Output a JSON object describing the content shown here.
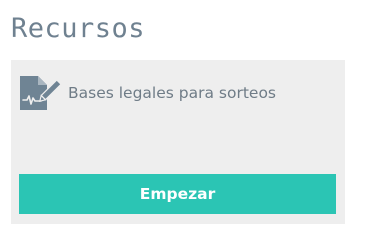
{
  "section": {
    "title": "Recursos"
  },
  "resources": [
    {
      "label": "Bases legales para sorteos",
      "icon": "document-signature-icon"
    }
  ],
  "action": {
    "button_label": "Empezar"
  },
  "colors": {
    "title": "#6f8190",
    "card_background": "#eeeeee",
    "icon": "#6f8494",
    "label": "#6f7c87",
    "button_background": "#2bc5b4",
    "button_text": "#ffffff"
  }
}
